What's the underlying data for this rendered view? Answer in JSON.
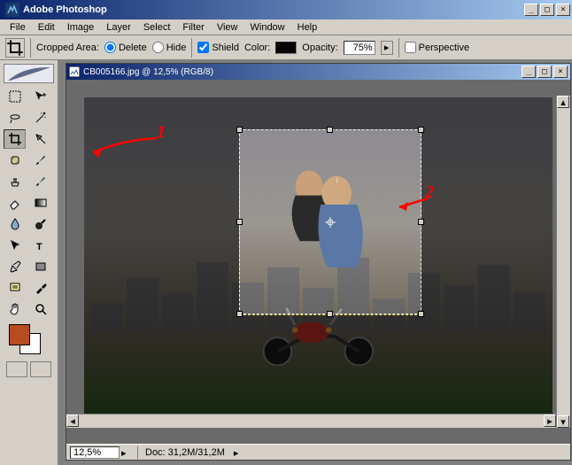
{
  "app": {
    "title": "Adobe Photoshop"
  },
  "menu": [
    "File",
    "Edit",
    "Image",
    "Layer",
    "Select",
    "Filter",
    "View",
    "Window",
    "Help"
  ],
  "options": {
    "cropped_area_label": "Cropped Area:",
    "delete_label": "Delete",
    "hide_label": "Hide",
    "shield_label": "Shield",
    "color_label": "Color:",
    "opacity_label": "Opacity:",
    "opacity_value": "75%",
    "perspective_label": "Perspective",
    "shield_checked": true,
    "cropped_mode": "delete",
    "perspective_checked": false,
    "shield_color": "#000000"
  },
  "document": {
    "title": "CB005166.jpg @ 12,5% (RGB/8)",
    "zoom": "12,5%",
    "doc_size": "Doc: 31,2M/31,2M"
  },
  "colors": {
    "foreground": "#b54d1e",
    "background": "#ffffff"
  },
  "annotations": {
    "one": "1",
    "two": "2"
  },
  "tools": [
    {
      "name": "marquee"
    },
    {
      "name": "move"
    },
    {
      "name": "lasso"
    },
    {
      "name": "magic-wand"
    },
    {
      "name": "crop",
      "active": true
    },
    {
      "name": "slice"
    },
    {
      "name": "healing"
    },
    {
      "name": "brush"
    },
    {
      "name": "clone"
    },
    {
      "name": "history-brush"
    },
    {
      "name": "eraser"
    },
    {
      "name": "gradient"
    },
    {
      "name": "blur"
    },
    {
      "name": "dodge"
    },
    {
      "name": "path-select"
    },
    {
      "name": "type"
    },
    {
      "name": "pen"
    },
    {
      "name": "shape"
    },
    {
      "name": "notes"
    },
    {
      "name": "eyedropper"
    },
    {
      "name": "hand"
    },
    {
      "name": "zoom"
    }
  ]
}
